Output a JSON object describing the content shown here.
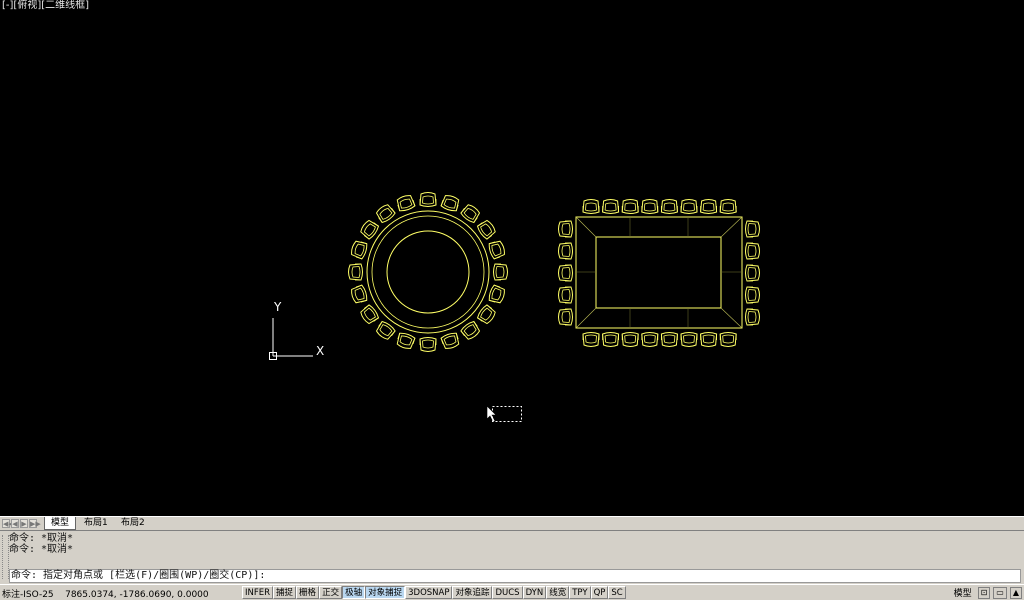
{
  "viewport": {
    "minus": "[-]",
    "view": "[俯视]",
    "style": "[二维线框]"
  },
  "colors": {
    "furniture": "#ffff66",
    "background": "#000000",
    "ucs": "#ffffff"
  },
  "ucs": {
    "y_label": "Y",
    "x_label": "X"
  },
  "tabs": {
    "nav": [
      "◀◀",
      "◀",
      "▶",
      "▶▶"
    ],
    "model": "模型",
    "layout1": "布局1",
    "layout2": "布局2"
  },
  "command": {
    "history": [
      "命令: *取消*",
      "命令: *取消*"
    ],
    "prompt": "命令: 指定对角点或 [栏选(F)/圈围(WP)/圈交(CP)]:"
  },
  "status": {
    "annotation": "标注-ISO-25",
    "coords": "7865.0374,  -1786.0690, 0.0000",
    "toggles": [
      {
        "label": "INFER",
        "on": false
      },
      {
        "label": "捕捉",
        "on": false
      },
      {
        "label": "栅格",
        "on": false
      },
      {
        "label": "正交",
        "on": false
      },
      {
        "label": "极轴",
        "on": true
      },
      {
        "label": "对象捕捉",
        "on": true
      },
      {
        "label": "3DOSNAP",
        "on": false
      },
      {
        "label": "对象追踪",
        "on": false
      },
      {
        "label": "DUCS",
        "on": false
      },
      {
        "label": "DYN",
        "on": false
      },
      {
        "label": "线宽",
        "on": false
      },
      {
        "label": "TPY",
        "on": false
      },
      {
        "label": "QP",
        "on": false
      },
      {
        "label": "SC",
        "on": false
      }
    ],
    "model_label": "模型"
  }
}
